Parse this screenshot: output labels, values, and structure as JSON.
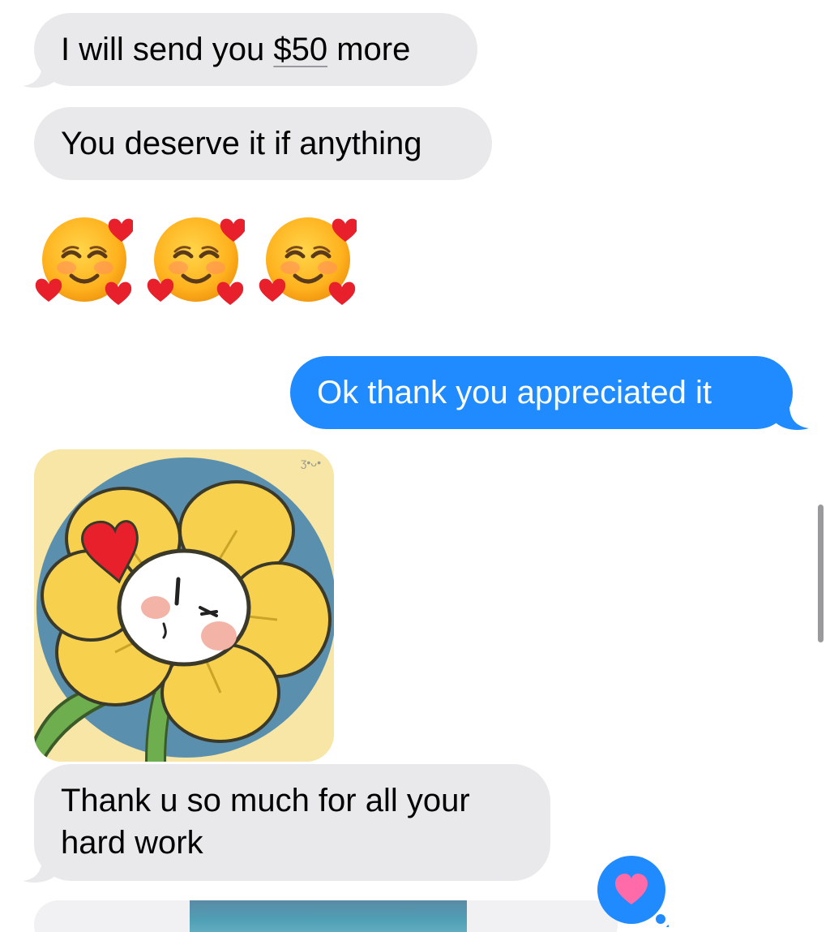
{
  "messages": {
    "m1": {
      "text_before": "I will send you ",
      "amount": "$50",
      "text_after": " more"
    },
    "m2": {
      "text": "You deserve it if anything"
    },
    "m3": {
      "emoji": "smiling-face-with-hearts",
      "count": 3
    },
    "m4": {
      "text": "Ok thank you appreciated it"
    },
    "m5": {
      "sticker": "flower-with-heart"
    },
    "m6": {
      "line1": "Thank u so much for all your",
      "line2": "hard work"
    },
    "m7": {
      "type": "photo"
    }
  },
  "reaction": {
    "icon": "heart-icon"
  },
  "colors": {
    "incoming_bubble": "#e9e9eb",
    "outgoing_bubble": "#1f8bff",
    "reaction_bg": "#1f8bff",
    "reaction_heart": "#ff6aa8"
  }
}
